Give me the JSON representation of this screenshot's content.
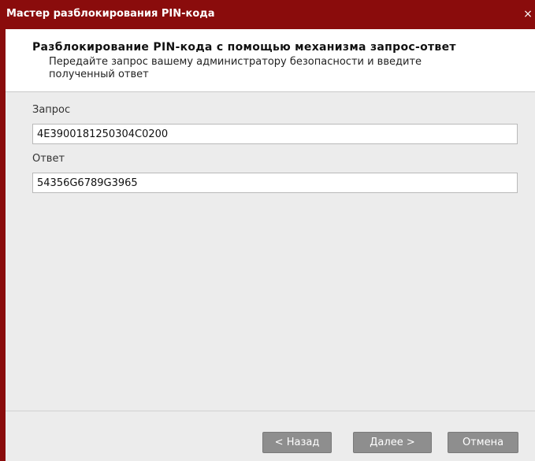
{
  "window": {
    "title": "Мастер разблокирования PIN-кода",
    "close_symbol": "×"
  },
  "header": {
    "title": "Разблокирование PIN-кода с помощью механизма запрос-ответ",
    "subtitle": "Передайте запрос вашему администратору безопасности и введите полученный ответ"
  },
  "form": {
    "request_label": "Запрос",
    "request_value": "4E3900181250304C0200",
    "response_label": "Ответ",
    "response_value": "54356G6789G3965"
  },
  "buttons": {
    "back": "< Назад",
    "next": "Далее >",
    "cancel": "Отмена"
  },
  "colors": {
    "titlebar": "#8a0c0c",
    "button": "#8e8e8e",
    "background": "#ececec"
  },
  "icons": {
    "close": "close-icon"
  }
}
